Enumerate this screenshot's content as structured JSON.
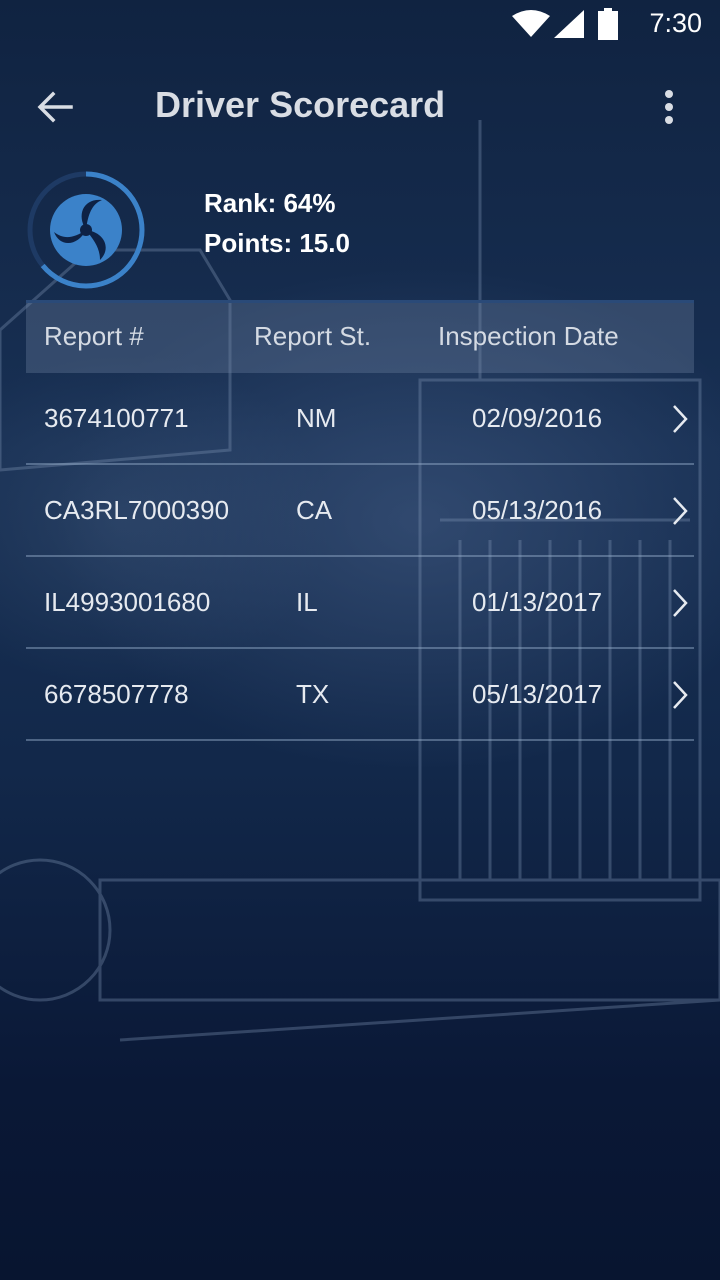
{
  "status_bar": {
    "time": "7:30",
    "icons": [
      "wifi-icon",
      "signal-icon",
      "battery-icon"
    ]
  },
  "app_bar": {
    "title": "Driver Scorecard",
    "back_icon": "arrow-back-icon",
    "menu_icon": "more-vertical-icon"
  },
  "score": {
    "rank_text": "Rank: 64%",
    "points_text": "Points: 15.0",
    "rank_progress_percent": 64,
    "logo_icon": "dot-triskelion-logo"
  },
  "table": {
    "headers": [
      "Report #",
      "Report St.",
      "Inspection Date"
    ],
    "rows": [
      {
        "report": "3674100771",
        "state": "NM",
        "date": "02/09/2016"
      },
      {
        "report": "CA3RL7000390",
        "state": "CA",
        "date": "05/13/2016"
      },
      {
        "report": "IL4993001680",
        "state": "IL",
        "date": "01/13/2017"
      },
      {
        "report": "6678507778",
        "state": "TX",
        "date": "05/13/2017"
      }
    ]
  },
  "colors": {
    "background": "#102341",
    "accent": "#3b82c9",
    "header_band": "#5a6f8f"
  }
}
